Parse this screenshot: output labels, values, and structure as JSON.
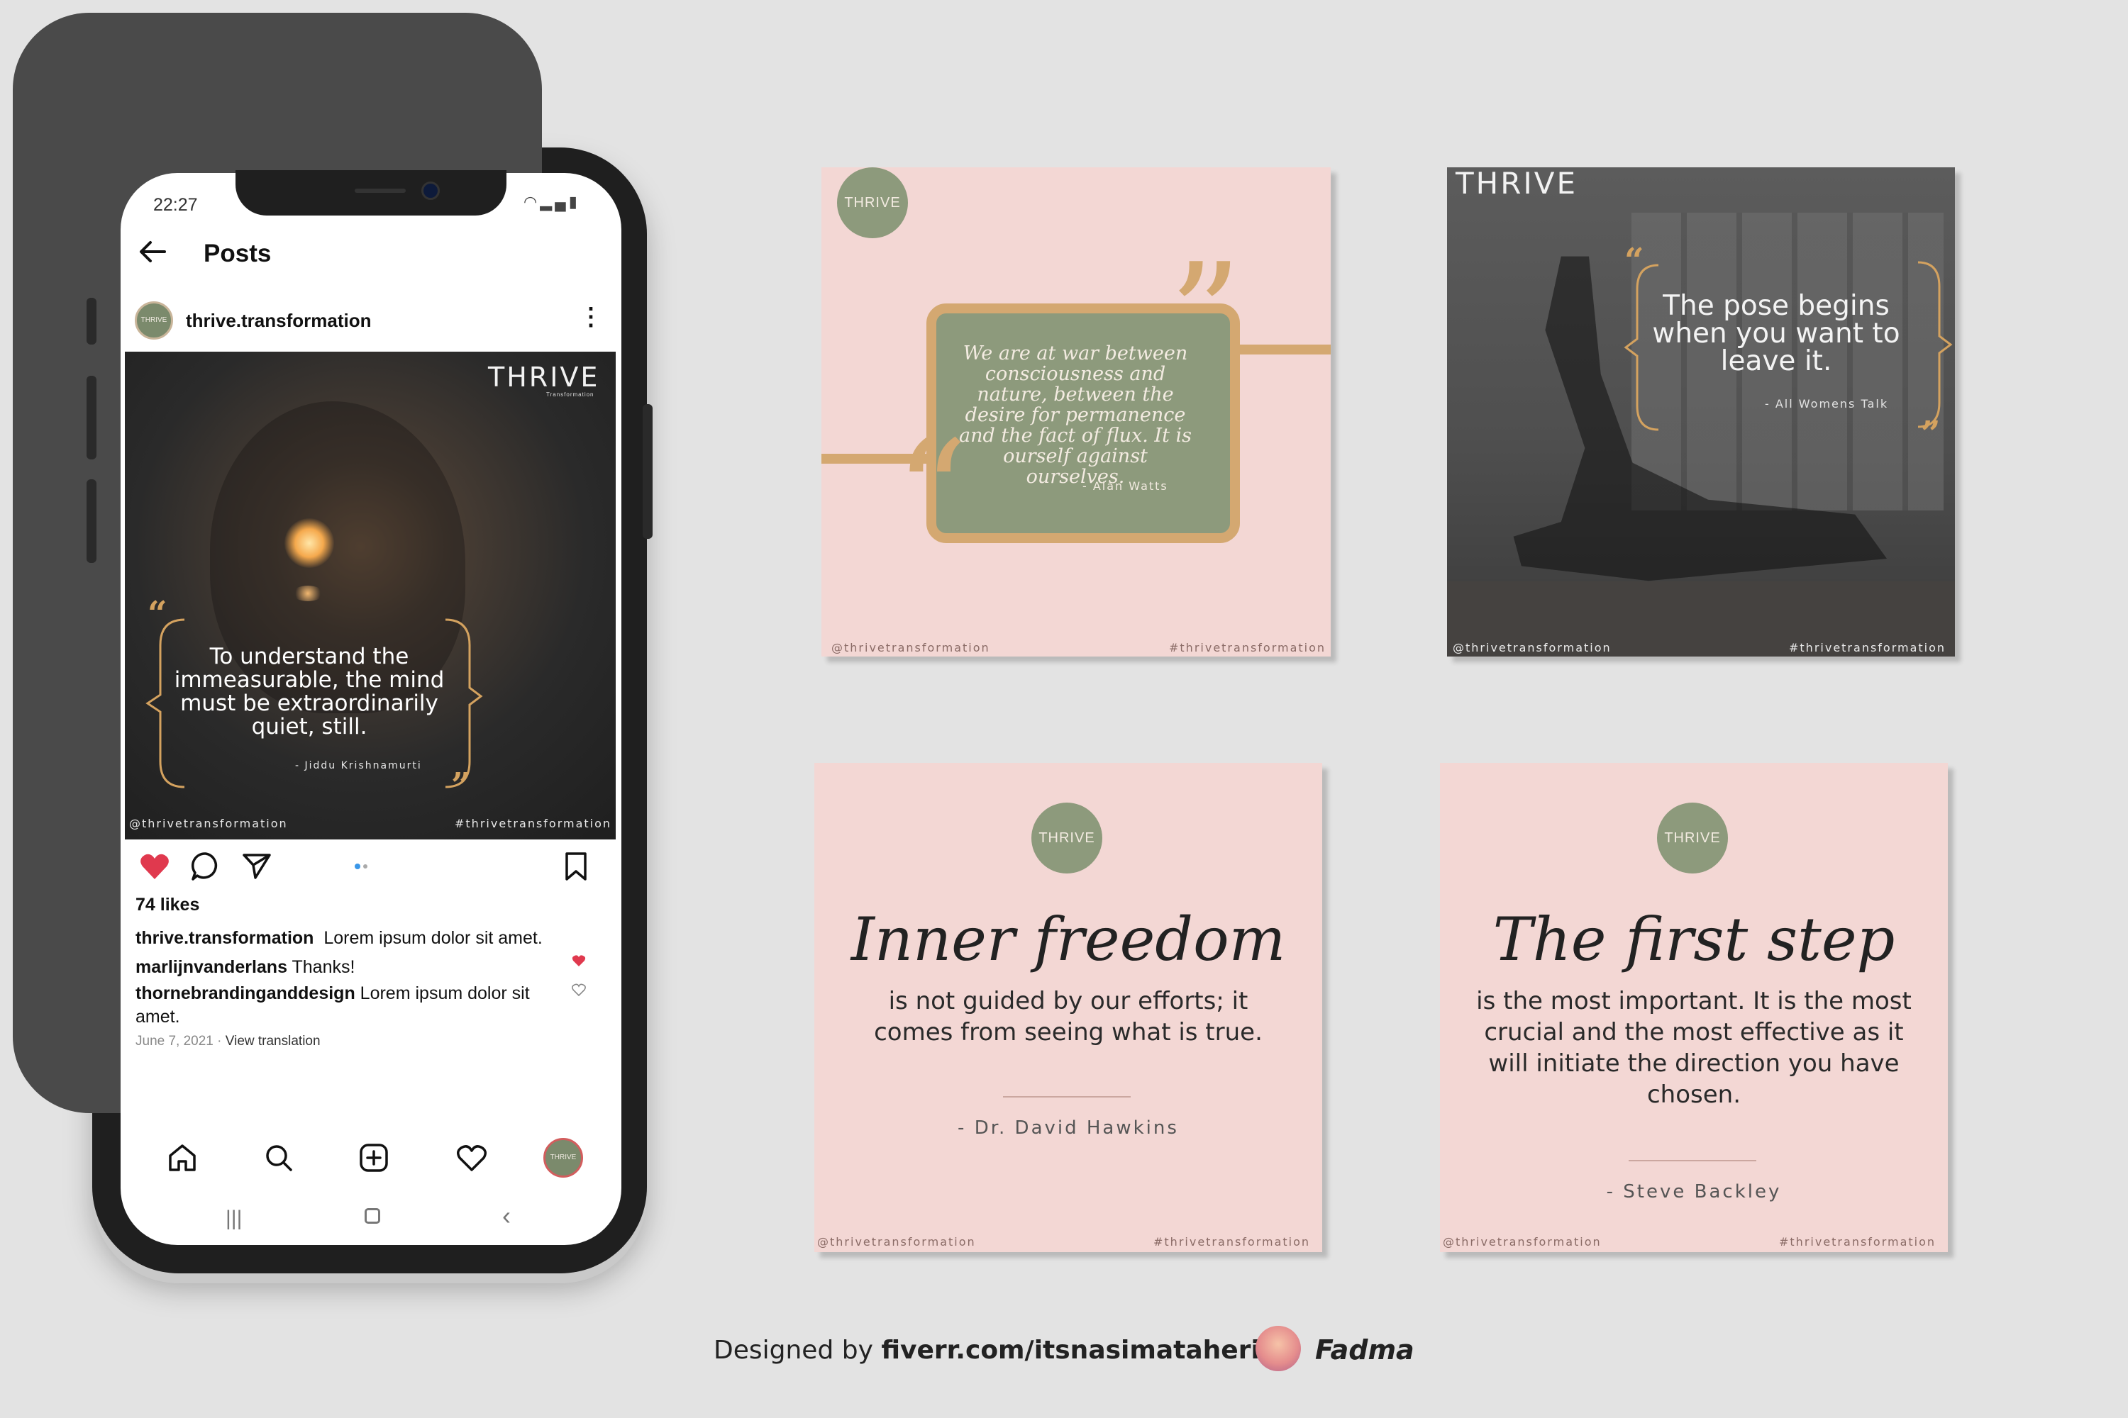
{
  "phone": {
    "status_time": "22:27",
    "header_title": "Posts",
    "username": "thrive.transformation",
    "avatar_label": "THRIVE",
    "post": {
      "brand": "THRIVE",
      "brand_sub": "Transformation",
      "quote": "To understand the immeasurable, the mind must be extraordinarily quiet, still.",
      "attribution": "- Jiddu Krishnamurti",
      "handle": "@thrivetransformation",
      "hashtag": "#thrivetransformation"
    },
    "likes": "74 likes",
    "caption_user": "thrive.transformation",
    "caption_text": "Lorem ipsum dolor sit amet.",
    "comment1_user": "marlijnvanderlans",
    "comment1_text": "Thanks!",
    "comment2_user": "thornebrandinganddesign",
    "comment2_text": "Lorem ipsum dolor sit amet.",
    "date": "June 7, 2021",
    "view_translation": "View translation"
  },
  "card1": {
    "brand": "THRIVE",
    "quote": "We are at war between consciousness and nature, between the desire for permanence and the fact of flux. It is ourself against ourselves.",
    "attribution": "- Alan Watts",
    "handle": "@thrivetransformation",
    "hashtag": "#thrivetransformation"
  },
  "card2": {
    "brand": "THRIVE",
    "quote": "The pose begins when you want to leave it.",
    "attribution": "- All Womens Talk",
    "handle": "@thrivetransformation",
    "hashtag": "#thrivetransformation"
  },
  "card3": {
    "brand": "THRIVE",
    "script": "Inner freedom",
    "body": "is not guided by our efforts; it comes from seeing what is true.",
    "attribution": "- Dr. David Hawkins",
    "handle": "@thrivetransformation",
    "hashtag": "#thrivetransformation"
  },
  "card4": {
    "brand": "THRIVE",
    "script": "The first step",
    "body": "is the most important. It is the most crucial and the most effective as it will initiate the direction you have chosen.",
    "attribution": "- Steve Backley",
    "handle": "@thrivetransformation",
    "hashtag": "#thrivetransformation"
  },
  "footer": {
    "designed_by": "Designed by",
    "link": "fiverr.com/itsnasimataheri",
    "name": "Fadma"
  },
  "colors": {
    "background": "#e3e3e3",
    "pink": "#f3d7d4",
    "sage": "#8d9a7c",
    "gold": "#d4a871",
    "like_red": "#e0394e"
  }
}
